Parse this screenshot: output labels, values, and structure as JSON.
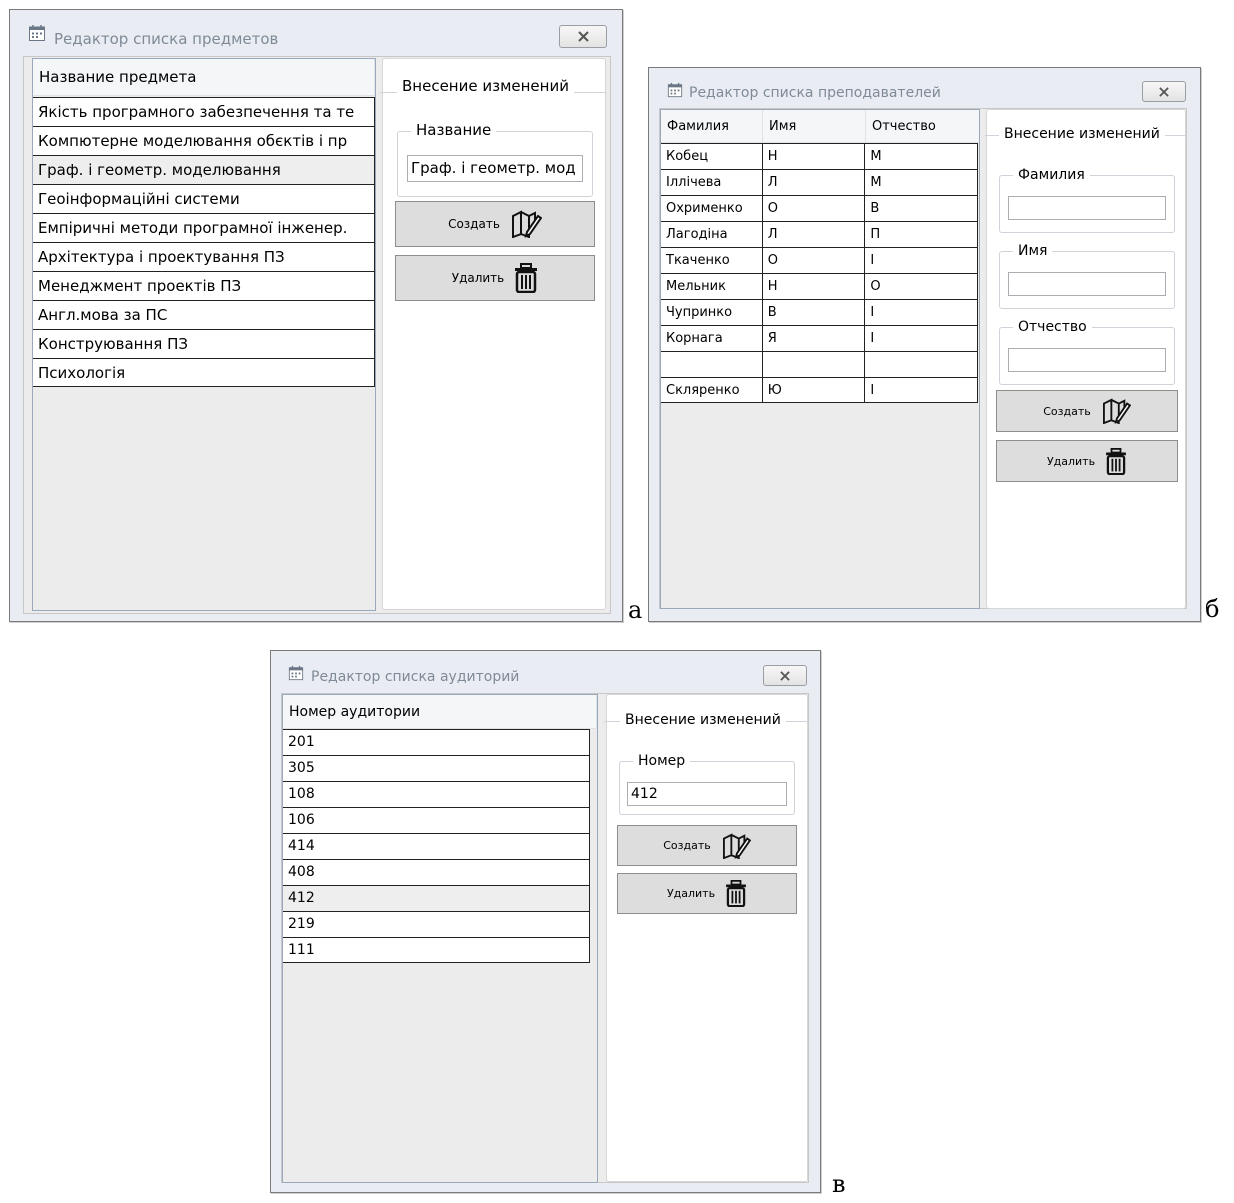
{
  "window_a": {
    "title": "Редактор списка предметов",
    "column_header": "Название предмета",
    "rows": [
      "Якість програмного забезпечення та те",
      "Компютерне моделювання обєктів і пр",
      "Граф. і геометр. моделювання",
      "Геоінформаційні системи",
      "Емпіричні методи програмної інженер.",
      "Архітектура і проектування ПЗ",
      "Менеджмент проектів ПЗ",
      "Англ.мова за ПС",
      "Конструювання ПЗ",
      "Психологія"
    ],
    "selected_row": 2,
    "panel_title": "Внесение изменений",
    "field_label": "Название",
    "field_value": "Граф. і геометр. мод",
    "create_label": "Создать",
    "delete_label": "Удалить"
  },
  "window_b": {
    "title": "Редактор списка преподавателей",
    "headers": [
      "Фамилия",
      "Имя",
      "Отчество"
    ],
    "rows": [
      [
        "Кобец",
        "Н",
        "М"
      ],
      [
        "Іллічева",
        "Л",
        "М"
      ],
      [
        "Охрименко",
        "О",
        "В"
      ],
      [
        "Лагодіна",
        "Л",
        "П"
      ],
      [
        "Ткаченко",
        "О",
        "І"
      ],
      [
        "Мельник",
        "Н",
        "О"
      ],
      [
        "Чупринко",
        "В",
        "І"
      ],
      [
        "Корнага",
        "Я",
        "І"
      ],
      [
        "",
        "",
        ""
      ],
      [
        "Скляренко",
        "Ю",
        "І"
      ]
    ],
    "panel_title": "Внесение изменений",
    "surname_label": "Фамилия",
    "surname_value": "",
    "name_label": "Имя",
    "name_value": "",
    "patronymic_label": "Отчество",
    "patronymic_value": "",
    "create_label": "Создать",
    "delete_label": "Удалить"
  },
  "window_c": {
    "title": "Редактор списка аудиторий",
    "column_header": "Номер аудитории",
    "rows": [
      "201",
      "305",
      "108",
      "106",
      "414",
      "408",
      "412",
      "219",
      "111"
    ],
    "selected_row": 6,
    "panel_title": "Внесение изменений",
    "field_label": "Номер",
    "field_value": "412",
    "create_label": "Создать",
    "delete_label": "Удалить"
  },
  "captions": {
    "a": "а",
    "b": "б",
    "c": "в"
  },
  "icons": {
    "title": "calendar-icon",
    "close": "close-icon",
    "create": "edit-icon",
    "delete": "trash-icon"
  },
  "colors": {
    "window_bg": "#e9edf3",
    "title_text": "#7f8a96",
    "grid_bg": "#ececec",
    "button_bg": "#dddddd",
    "selected_row": "#eeeeee"
  }
}
